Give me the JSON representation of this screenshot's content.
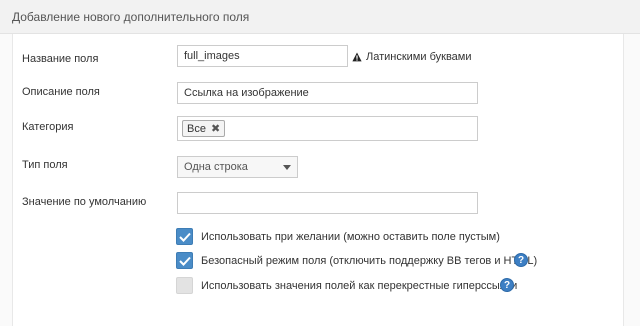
{
  "panel": {
    "title": "Добавление нового дополнительного поля"
  },
  "fields": {
    "name": {
      "label": "Название поля",
      "value": "full_images",
      "hint": "Латинскими буквами"
    },
    "description": {
      "label": "Описание поля",
      "value": "Ссылка на изображение"
    },
    "category": {
      "label": "Категория",
      "tag": "Все",
      "tag_remove": "✖"
    },
    "type": {
      "label": "Тип поля",
      "selected": "Одна строка"
    },
    "default": {
      "label": "Значение по умолчанию",
      "value": ""
    }
  },
  "options": [
    {
      "label": "Использовать при желании (можно оставить поле пустым)",
      "checked": true,
      "help": false
    },
    {
      "label": "Безопасный режим поля (отключить поддержку BB тегов и HTML)",
      "checked": true,
      "help": true
    },
    {
      "label": "Использовать значения полей как перекрестные гиперссылки",
      "checked": false,
      "help": true
    }
  ],
  "help_glyph": "?",
  "icons": {
    "warning": "warning-triangle-icon",
    "help": "help-circle-icon",
    "check": "check-icon"
  },
  "colors": {
    "accent": "#4a8cc7",
    "help": "#3d7fc4",
    "border": "#cccccc"
  }
}
